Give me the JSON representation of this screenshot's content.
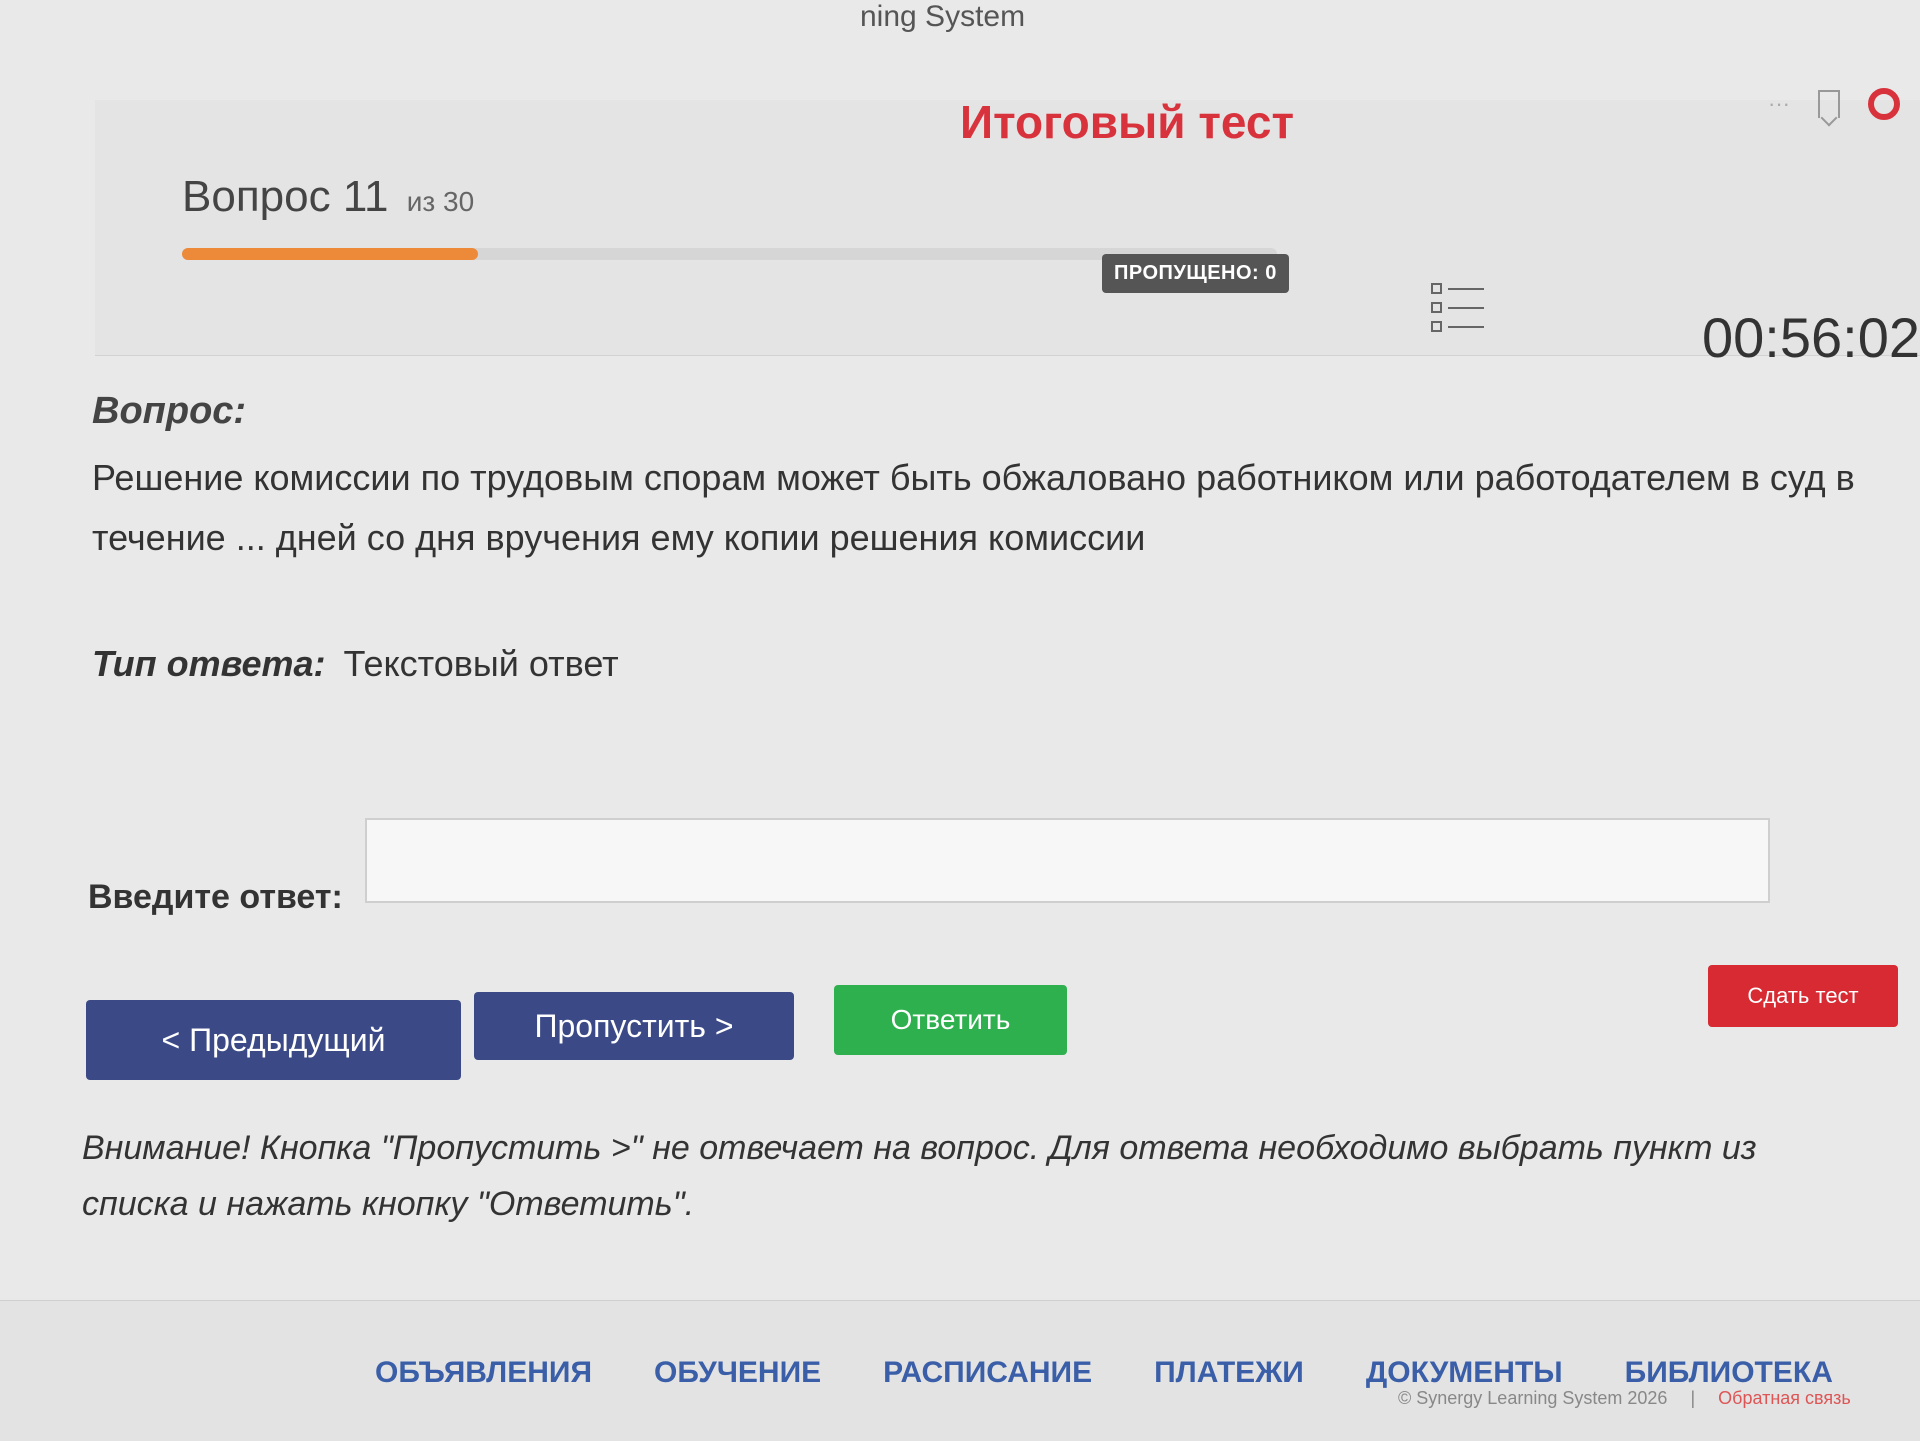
{
  "brand": "ning System",
  "page_title": "Итоговый тест",
  "question": {
    "counter_prefix": "Вопрос",
    "number": "11",
    "of_text": "из 30",
    "progress_fraction": 0.27,
    "skipped_label": "ПРОПУЩЕНО: 0",
    "timer": "00:56:02",
    "label": "Вопрос:",
    "text": "Решение комиссии по трудовым спорам может быть обжаловано работником или работодателем в суд в течение ... дней со дня вручения ему копии решения комиссии",
    "type_label": "Тип ответа:",
    "type_value": "Текстовый ответ"
  },
  "answer": {
    "label": "Введите ответ:",
    "value": "",
    "placeholder": ""
  },
  "buttons": {
    "prev": "< Предыдущий",
    "skip": "Пропустить >",
    "answer": "Ответить",
    "finish": "Сдать тест"
  },
  "warning": "Внимание! Кнопка \"Пропустить >\" не отвечает на вопрос. Для ответа необходимо выбрать пункт из списка и нажать кнопку \"Ответить\".",
  "footer": {
    "nav": [
      "ОБЪЯВЛЕНИЯ",
      "ОБУЧЕНИЕ",
      "РАСПИСАНИЕ",
      "ПЛАТЕЖИ",
      "ДОКУМЕНТЫ",
      "БИБЛИОТЕКА"
    ],
    "copyright": "© Synergy Learning System 2026",
    "separator": "|",
    "feedback": "Обратная связь"
  },
  "colors": {
    "accent_red": "#d8333c",
    "progress_orange": "#ec8a3a",
    "nav_blue": "#3a5fa8",
    "button_blue": "#3b4a86",
    "button_green": "#2fb04f"
  }
}
